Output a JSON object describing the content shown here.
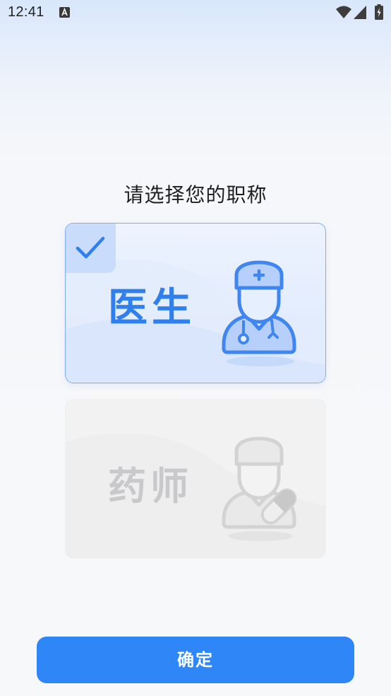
{
  "status_bar": {
    "time": "12:41",
    "icons": [
      "app-notification-icon",
      "wifi-icon",
      "cellular-signal-icon",
      "battery-icon"
    ]
  },
  "page": {
    "title": "请选择您的职称"
  },
  "roles": [
    {
      "label": "医生",
      "icon": "doctor-icon",
      "selected": true
    },
    {
      "label": "药师",
      "icon": "pharmacist-icon",
      "selected": false
    }
  ],
  "confirm_button": {
    "label": "确定"
  },
  "colors": {
    "accent": "#2e86f7",
    "selected_text": "#2f80ed",
    "disabled_text": "#c9c9cb",
    "title_text": "#1f1f1f"
  }
}
